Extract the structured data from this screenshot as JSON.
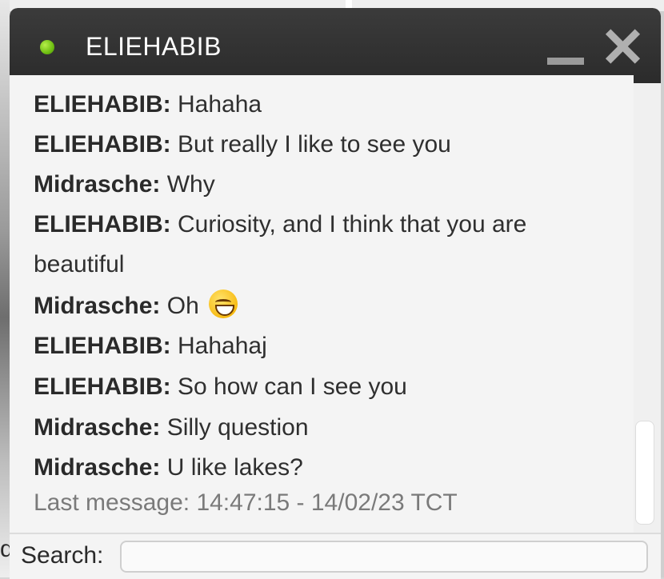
{
  "window": {
    "title": "ELIEHABIB",
    "status": "online",
    "status_color": "#7ac41a",
    "minimize_icon": "minimize-icon",
    "close_icon": "close-icon"
  },
  "messages": [
    {
      "sender": "ELIEHABIB:",
      "text": "Hahaha"
    },
    {
      "sender": "ELIEHABIB:",
      "text": "But really I like to see you"
    },
    {
      "sender": "Midrasche:",
      "text": "Why"
    },
    {
      "sender": "ELIEHABIB:",
      "text": "Curiosity, and I think that you are",
      "text_cont": "beautiful"
    },
    {
      "sender": "Midrasche:",
      "text": "Oh",
      "emoji": "grinning-face-emoji"
    },
    {
      "sender": "ELIEHABIB:",
      "text": "Hahahaj"
    },
    {
      "sender": "ELIEHABIB:",
      "text": "So how can I see you"
    },
    {
      "sender": "Midrasche:",
      "text": "Silly question"
    },
    {
      "sender": "Midrasche:",
      "text": "U like lakes?"
    }
  ],
  "last_message": "Last message: 14:47:15 - 14/02/23 TCT",
  "search": {
    "label": "Search:",
    "value": "",
    "left_edge_char": "d"
  }
}
